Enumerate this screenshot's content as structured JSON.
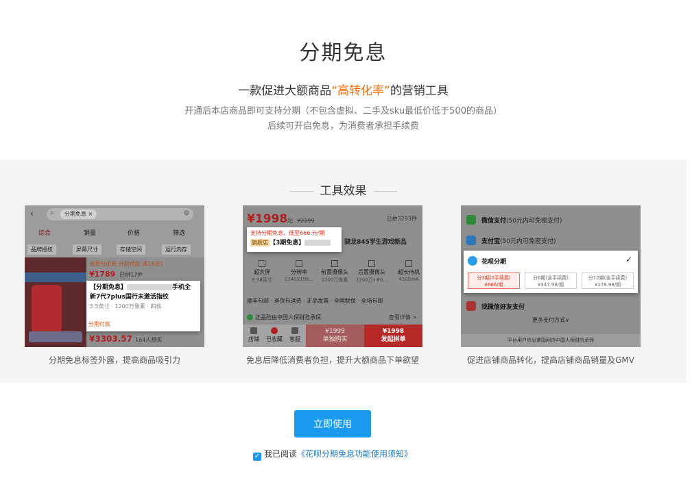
{
  "hero": {
    "title": "分期免息",
    "subtitle_pre": "一款促进大额商品",
    "subtitle_highlight": "“高转化率”",
    "subtitle_post": "的营销工具",
    "desc_line1": "开通后本店商品即可支持分期（不包含虚拟、二手及sku最低价低于500的商品）",
    "desc_line2": "后续可开启免息，为消费者承担手续费",
    "highlight_color": "#ff6a00"
  },
  "effects": {
    "title": "工具效果",
    "cards": [
      {
        "caption": "分期免息标签外露，提高商品吸引力",
        "search_pill": "分期免息",
        "sort_tabs": [
          "综合",
          "销量",
          "价格",
          "筛选"
        ],
        "filters": [
          "品牌授权",
          "屏幕尺寸",
          "存储空间",
          "运行内存"
        ],
        "promo_tags": "退货包运费  分期付款  满18送1",
        "price1": "¥1789",
        "price1_note": "已拼17件",
        "product_title_a": "【分期免息】",
        "product_title_b": "手机全",
        "product_title_c": "新7代7plus国行未激活指纹",
        "product_spec": "5.5英寸 · 1200万像素 · 四核",
        "product_tag": "分期付款",
        "price2": "¥3303.57",
        "price2_note": "164人想买"
      },
      {
        "caption": "免息后降低消费者负担，提升大额商品下单欲望",
        "price": "¥1998",
        "price_suffix": "起",
        "price_old": "¥2299",
        "sold": "已拼3293件",
        "popup_line1": "支持分期免息，低至666.元/期",
        "flagship": "旗舰店",
        "popup_line2": "【3期免息】",
        "title_tail": "骁龙845学生游戏新品",
        "specs": [
          {
            "name": "超大屏",
            "value": "6.38英寸"
          },
          {
            "name": "分辨率",
            "value": "2340X108..."
          },
          {
            "name": "前置摄像头",
            "value": "1200万像素"
          },
          {
            "name": "后置摄像头",
            "value": "1200万+80..."
          },
          {
            "name": "超长待机",
            "value": "4500mA"
          }
        ],
        "services": "顺丰包邮 · 退货包运费 · 正品发票 · 全国联保 · 全场包邮",
        "insurance": "正品险由中国人保财险承保",
        "detail": "查看详情 >",
        "bar_icons": [
          "店铺",
          "已收藏",
          "客服"
        ],
        "solo_price": "¥1999",
        "solo_label": "单独购买",
        "group_price": "¥1998",
        "group_label": "发起拼单"
      },
      {
        "caption": "促进店铺商品转化，提高店铺商品销量及GMV",
        "pay_rows": [
          {
            "name": "微信支付",
            "note": "(50元内可免密支付)"
          },
          {
            "name": "支付宝",
            "note": "(50元内可免密支付)"
          }
        ],
        "huabei": "花呗分期",
        "check": "✓",
        "options": [
          {
            "line1": "分3期(0手续费)",
            "line2": "¥666/期"
          },
          {
            "line1": "分6期(含手续费)",
            "line2": "¥347.98/期"
          },
          {
            "line1": "分12期(含手续费)",
            "line2": "¥178.98/期"
          }
        ],
        "friend_pay": "找微信好友支付",
        "more_pay": "更多支付方式∨",
        "footer": "平台用户信息遭国网由中国人保财险承保"
      }
    ]
  },
  "action": {
    "use_button": "立即使用",
    "agree_prefix": "我已阅读",
    "agree_link": "《花呗分期免息功能使用须知》",
    "agreed": true,
    "button_color": "#1a9bf0"
  }
}
